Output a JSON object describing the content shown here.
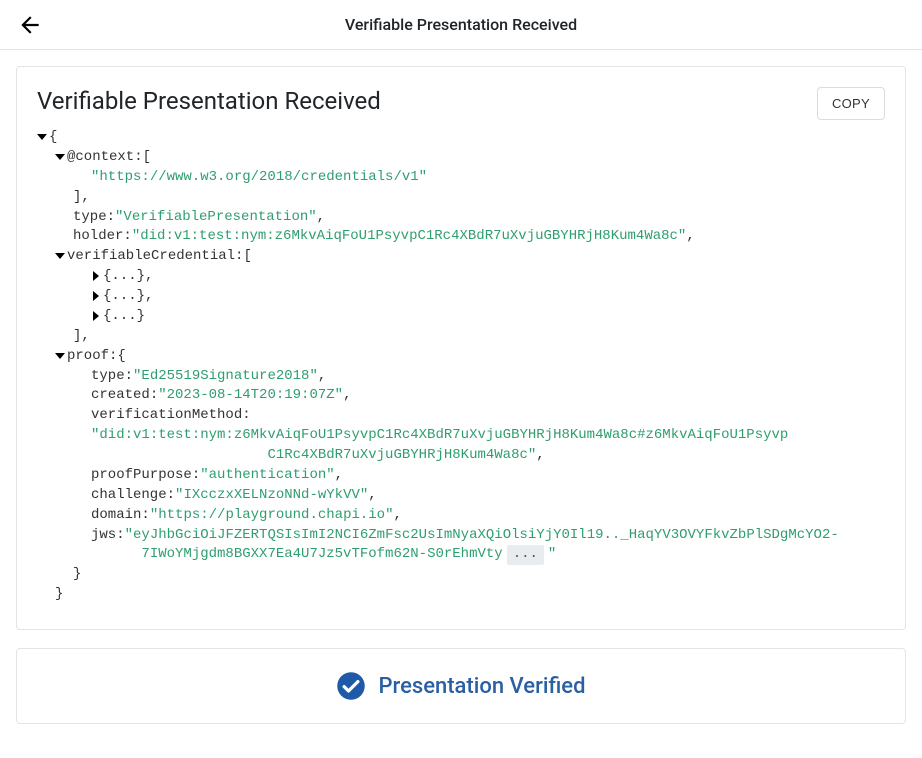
{
  "header": {
    "title": "Verifiable Presentation Received"
  },
  "card": {
    "title": "Verifiable Presentation Received",
    "copy_label": "COPY"
  },
  "json": {
    "open_brace": "{",
    "close_brace": "}",
    "open_sq": "[",
    "close_sq": "]",
    "close_sq_comma": "],",
    "comma": ",",
    "colon_sp": ": ",
    "q": "\"",
    "collapsed_obj": "{...}",
    "ellipsis_badge": "...",
    "keys": {
      "context": "@context",
      "type": "type",
      "holder": "holder",
      "verifiableCredential": "verifiableCredential",
      "proof": "proof",
      "created": "created",
      "verificationMethod": "verificationMethod",
      "proofPurpose": "proofPurpose",
      "challenge": "challenge",
      "domain": "domain",
      "jws": "jws"
    },
    "values": {
      "context0": "https://www.w3.org/2018/credentials/v1",
      "vp_type": "VerifiablePresentation",
      "holder": "did:v1:test:nym:z6MkvAiqFoU1PsyvpC1Rc4XBdR7uXvjuGBYHRjH8Kum4Wa8c",
      "proof_type": "Ed25519Signature2018",
      "created": "2023-08-14T20:19:07Z",
      "vm_line1": "did:v1:test:nym:z6MkvAiqFoU1PsyvpC1Rc4XBdR7uXvjuGBYHRjH8Kum4Wa8c#z6MkvAiqFoU1Psyvp",
      "vm_line2": "C1Rc4XBdR7uXvjuGBYHRjH8Kum4Wa8c",
      "proofPurpose": "authentication",
      "challenge": "IXcczxXELNzoNNd-wYkVV",
      "domain": "https://playground.chapi.io",
      "jws_line1": "eyJhbGciOiJFZERTQSIsImI2NCI6ZmFsc2UsImNyaXQiOlsiYjY0Il19.._HaqYV3OVYFkvZbPlSDgMcYO2-",
      "jws_line2": "7IWoYMjgdm8BGXX7Ea4U7Jz5vTFofm62N-S0rEhmVty "
    }
  },
  "status": {
    "text": "Presentation Verified",
    "color": "#2b5fa4",
    "icon_bg": "#1e5aa8"
  }
}
